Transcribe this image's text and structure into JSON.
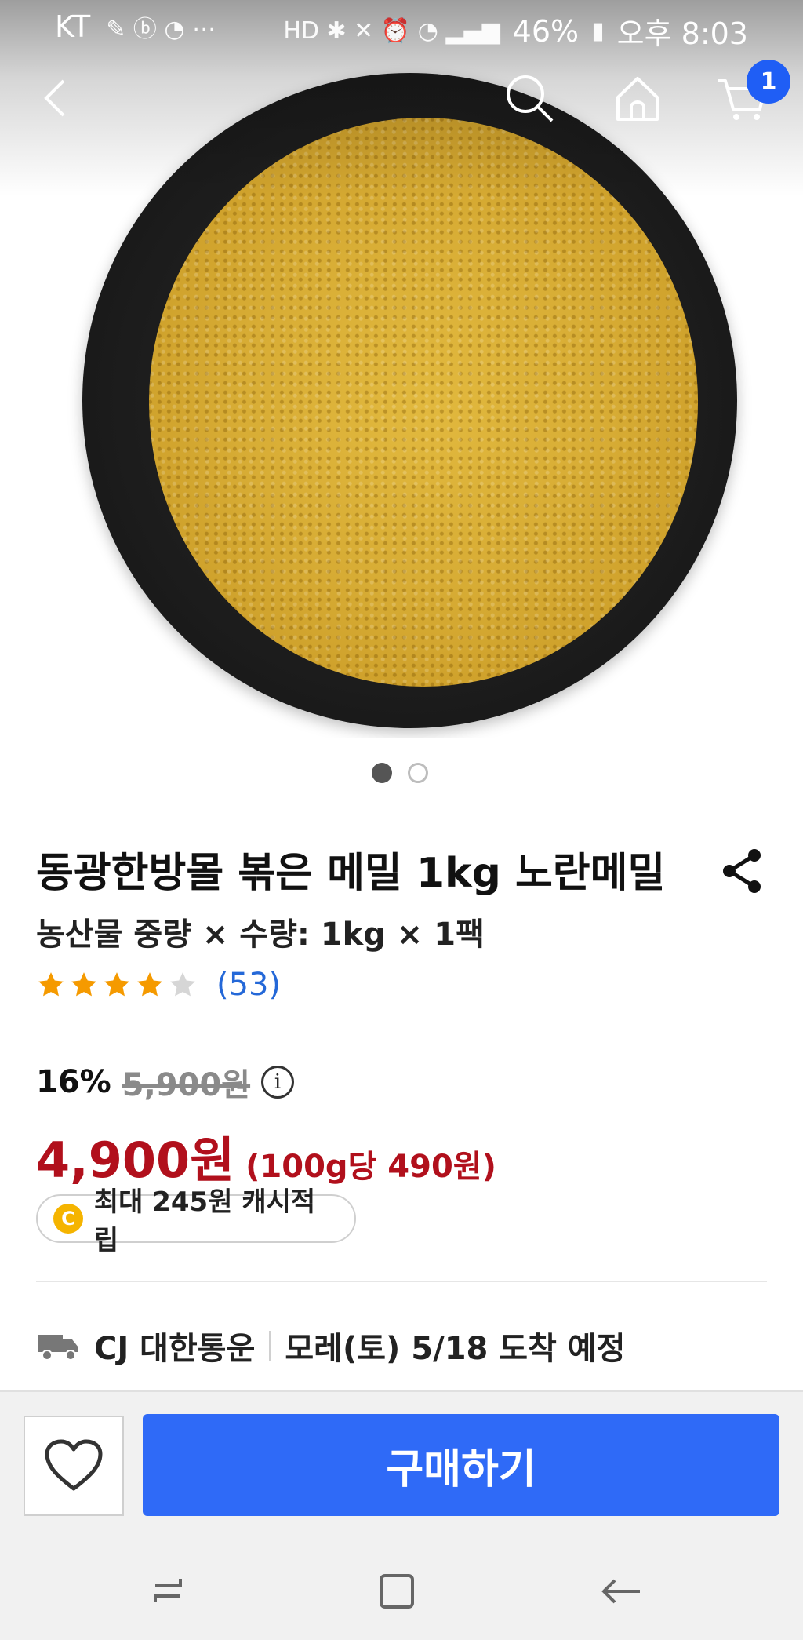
{
  "status_bar": {
    "carrier": "KT",
    "battery": "46%",
    "time": "오후 8:03"
  },
  "nav": {
    "cart_count": "1"
  },
  "product": {
    "title": "동광한방몰 볶은 메밀 1kg 노란메밀",
    "option": "농산물 중량 × 수량: 1kg × 1팩",
    "rating": 4,
    "review_count": "(53)"
  },
  "price": {
    "discount_rate": "16%",
    "original_price": "5,900원",
    "sale_price": "4,900원",
    "unit_price": "(100g당 490원)"
  },
  "cash": {
    "coin_label": "C",
    "text": "최대 245원 캐시적립"
  },
  "delivery": {
    "carrier": "CJ 대한통운",
    "eta": "모레(토) 5/18 도착 예정"
  },
  "actions": {
    "buy_label": "구매하기"
  },
  "colors": {
    "accent_blue": "#2f6af7",
    "price_red": "#b1101c",
    "star_orange": "#f59a00"
  }
}
